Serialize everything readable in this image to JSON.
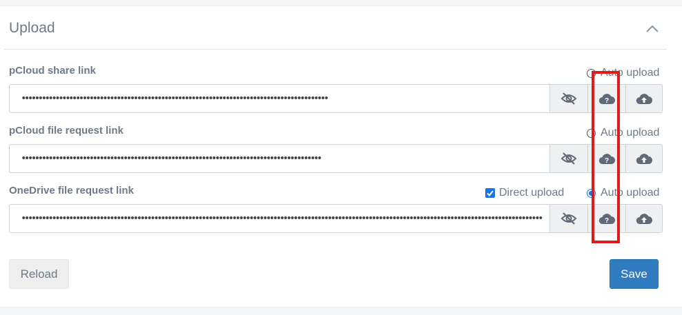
{
  "panel": {
    "title": "Upload"
  },
  "fields": [
    {
      "label": "pCloud share link",
      "value": "••••••••••••••••••••••••••••••••••••••••••••••••••••••••••••••••••••••••••••••••••••••••••",
      "auto_upload_label": "Auto upload",
      "auto_upload_checked": false
    },
    {
      "label": "pCloud file request link",
      "value": "••••••••••••••••••••••••••••••••••••••••••••••••••••••••••••••••••••••••••••••••••••••••",
      "auto_upload_label": "Auto upload",
      "auto_upload_checked": false
    },
    {
      "label": "OneDrive file request link",
      "value": "••••••••••••••••••••••••••••••••••••••••••••••••••••••••••••••••••••••••••••••••••••••••••••••••••••••••••••••••••••••••••••••••••••••••••••••••••••••••••",
      "auto_upload_label": "Auto upload",
      "auto_upload_checked": true,
      "direct_upload_label": "Direct upload",
      "direct_upload_checked": true
    }
  ],
  "buttons": {
    "reload": "Reload",
    "save": "Save"
  },
  "icons": {
    "collapse": "chevron-up-icon",
    "visibility": "eye-off-icon",
    "status": "cloud-question-icon",
    "upload": "cloud-upload-icon"
  },
  "colors": {
    "accent": "#1a73e8",
    "save": "#2f7cc1",
    "highlight": "#e01b1b",
    "text": "#6c7a89"
  }
}
